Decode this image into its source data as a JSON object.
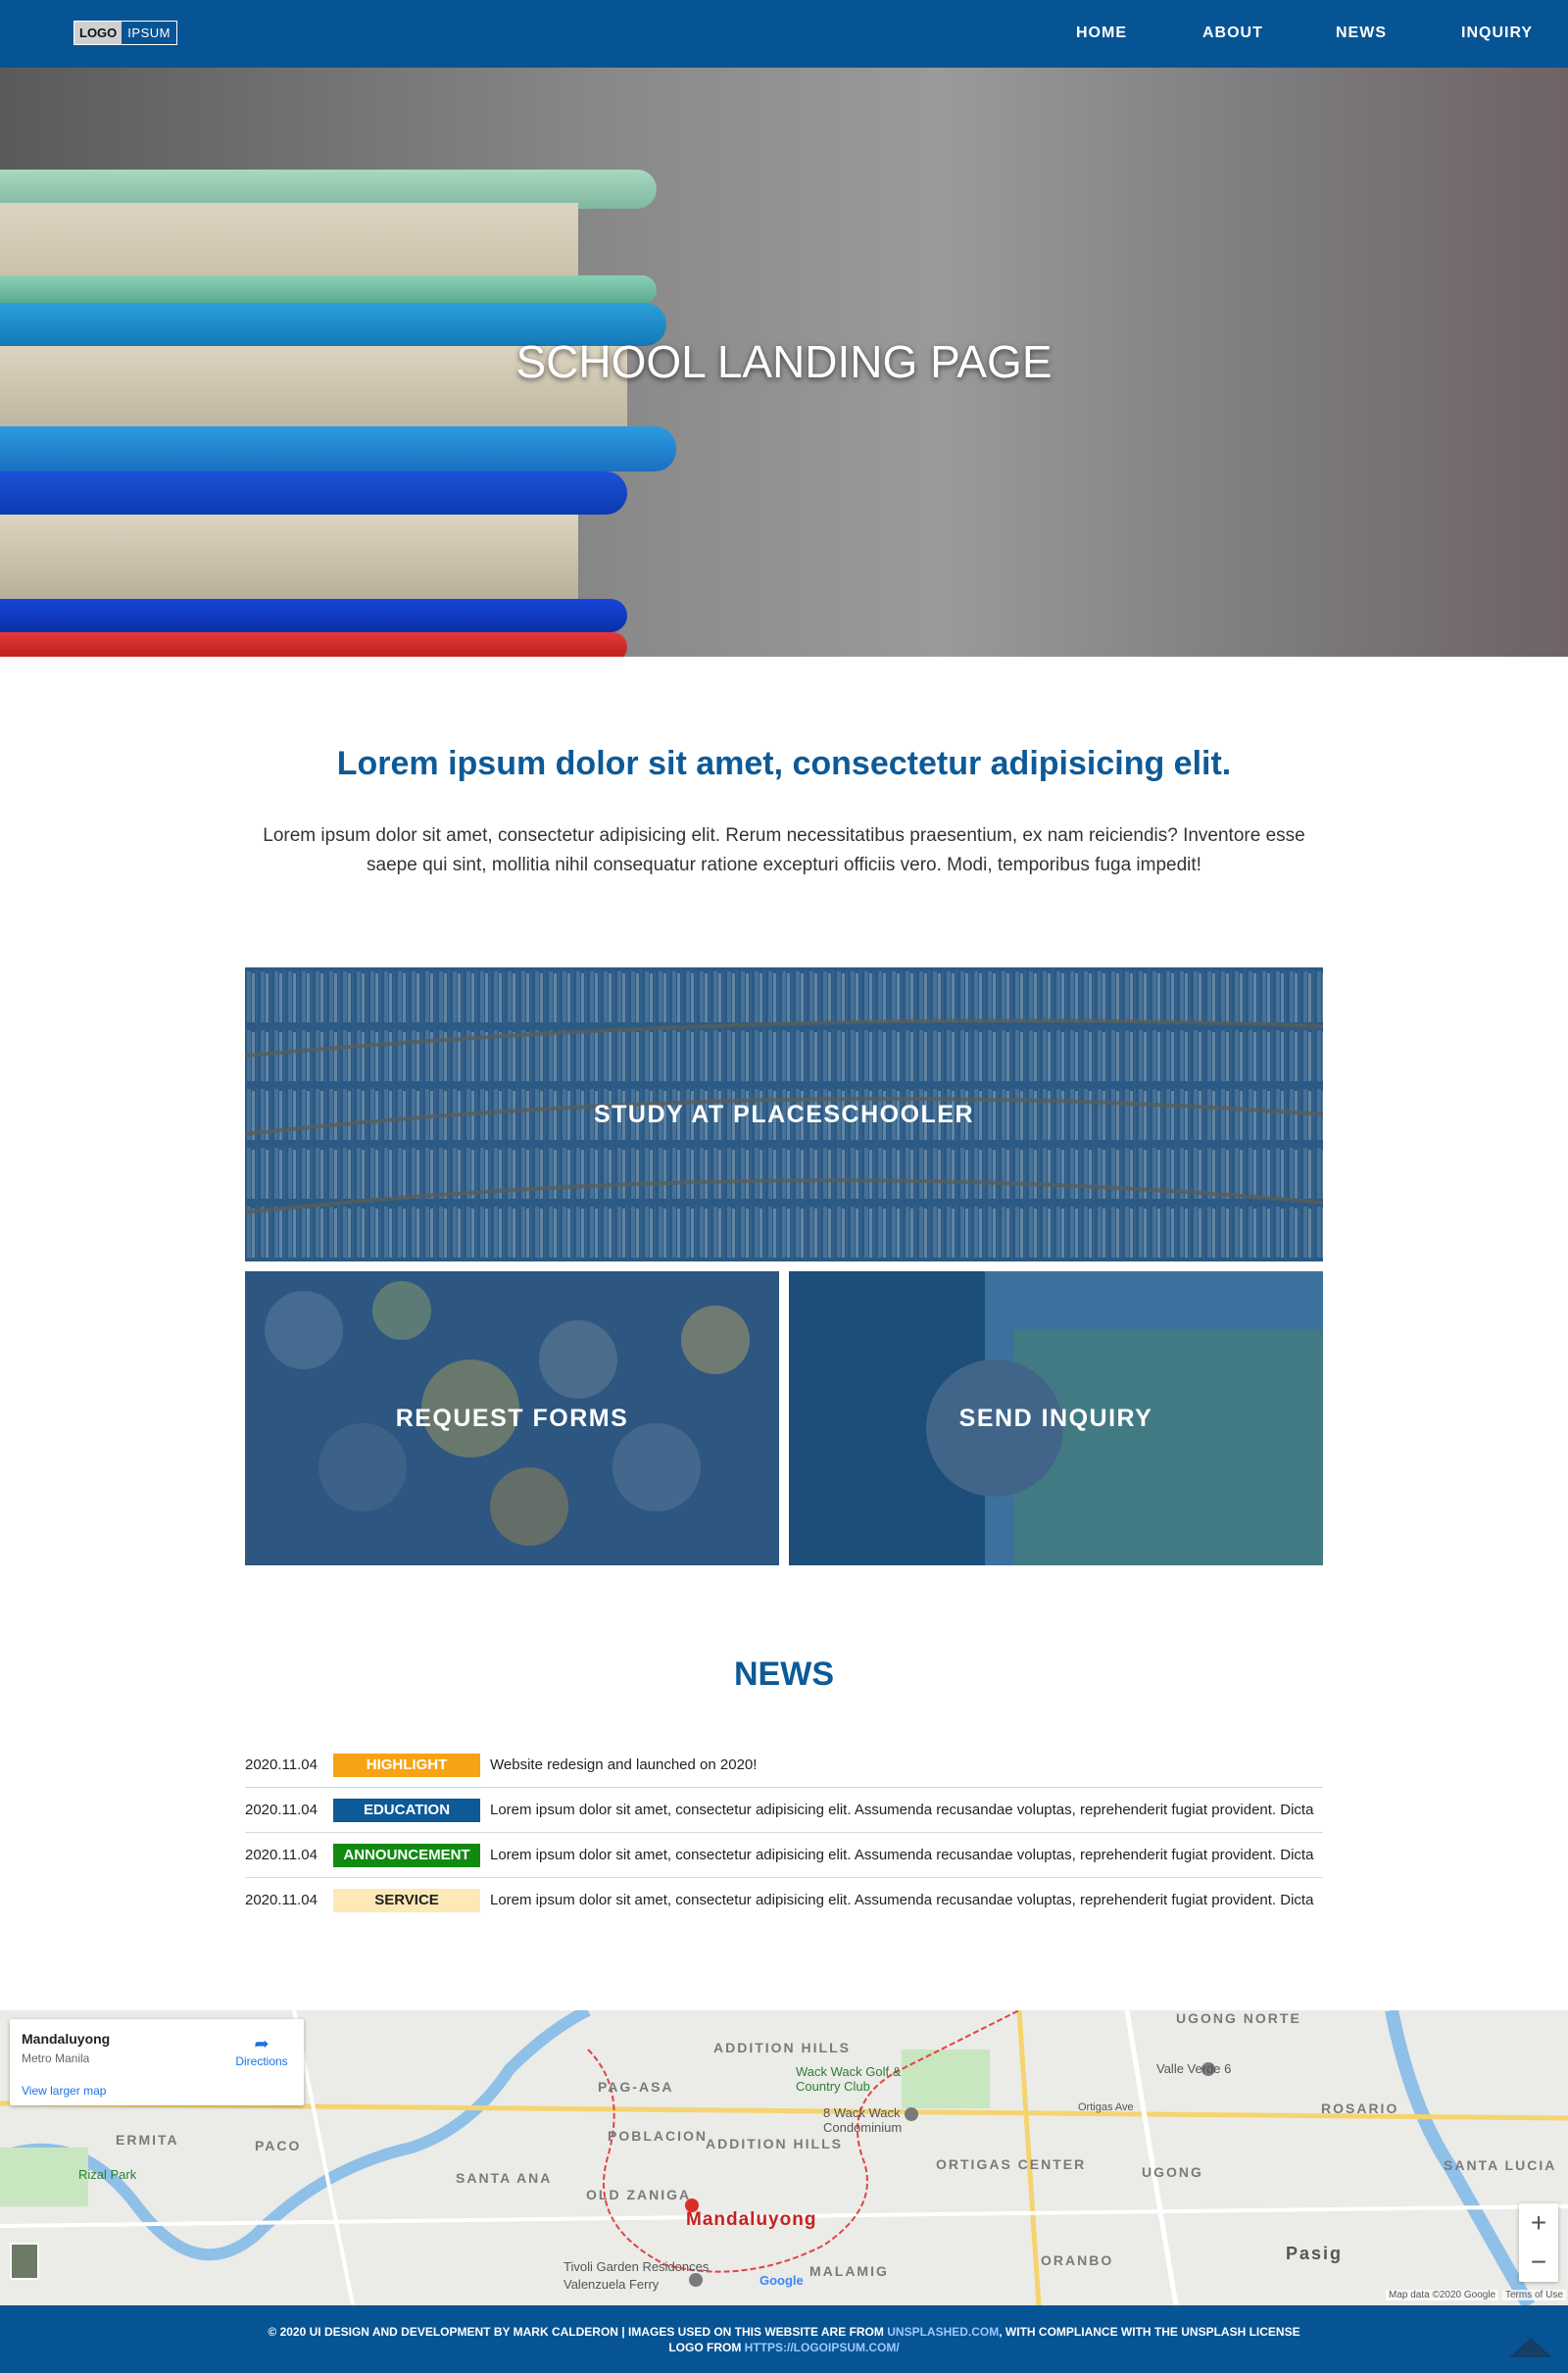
{
  "header": {
    "logo_part1": "LOGO",
    "logo_part2": "IPSUM",
    "nav": [
      "HOME",
      "ABOUT",
      "NEWS",
      "INQUIRY"
    ]
  },
  "hero": {
    "title": "SCHOOL LANDING PAGE"
  },
  "intro": {
    "heading": "Lorem ipsum dolor sit amet, consectetur adipisicing elit.",
    "text": "Lorem ipsum dolor sit amet, consectetur adipisicing elit. Rerum necessitatibus praesentium, ex nam reiciendis? Inventore esse saepe qui sint, mollitia nihil consequatur ratione excepturi officiis vero. Modi, temporibus fuga impedit!"
  },
  "cards": {
    "study": "STUDY AT PLACESCHOOLER",
    "forms": "REQUEST FORMS",
    "inquiry": "SEND INQUIRY"
  },
  "news": {
    "heading": "NEWS",
    "items": [
      {
        "date": "2020.11.04",
        "tag": "HIGHLIGHT",
        "tag_color": "#f7a314",
        "tag_text_color": "#ffffff",
        "text": "Website redesign and launched on 2020!"
      },
      {
        "date": "2020.11.04",
        "tag": "EDUCATION",
        "tag_color": "#0d5a98",
        "tag_text_color": "#ffffff",
        "text": "Lorem ipsum dolor sit amet, consectetur adipisicing elit. Assumenda recusandae voluptas, reprehenderit fugiat provident. Dicta"
      },
      {
        "date": "2020.11.04",
        "tag": "ANNOUNCEMENT",
        "tag_color": "#118a11",
        "tag_text_color": "#ffffff",
        "text": "Lorem ipsum dolor sit amet, consectetur adipisicing elit. Assumenda recusandae voluptas, reprehenderit fugiat provident. Dicta"
      },
      {
        "date": "2020.11.04",
        "tag": "SERVICE",
        "tag_color": "#fde9b8",
        "tag_text_color": "#222222",
        "text": "Lorem ipsum dolor sit amet, consectetur adipisicing elit. Assumenda recusandae voluptas, reprehenderit fugiat provident. Dicta"
      }
    ]
  },
  "map": {
    "place": "Mandaluyong",
    "region": "Metro Manila",
    "larger_map": "View larger map",
    "directions": "Directions",
    "labels": {
      "city": "Mandaluyong",
      "ortigas": "ORTIGAS CENTER",
      "addition_hills": "ADDITION HILLS",
      "poblacion": "POBLACION",
      "old_zaniga": "OLD ZANIGA",
      "malamig": "MALAMIG",
      "pag_asa": "PAG-ASA",
      "ugong": "UGONG",
      "ugong_norte": "UGONG NORTE",
      "rosario": "ROSARIO",
      "santa_lucia": "SANTA LUCIA",
      "santa_ana": "SANTA ANA",
      "ermita": "ERMITA",
      "paco": "PACO",
      "orano": "ORANBO",
      "pasig": "Pasig",
      "valle_verde": "Valle Verde 6",
      "wack_wack": "Wack Wack Golf & Country Club",
      "wack_wack_condo": "8 Wack Wack Condominium",
      "rizal_park": "Rizal Park",
      "tivoli": "Tivoli Garden Residences",
      "valenzuela": "Valenzuela Ferry",
      "ortigas_ave": "Ortigas Ave",
      "google": "Google",
      "map_data": "Map data ©2020 Google",
      "terms": "Terms of Use"
    }
  },
  "footer": {
    "line1_prefix": "© 2020 UI DESIGN AND DEVELOPMENT BY MARK CALDERON | IMAGES USED ON THIS WEBSITE ARE FROM ",
    "line1_link": "UNSPLASHED.COM",
    "line1_suffix": ", WITH COMPLIANCE WITH THE UNSPLASH LICENSE",
    "line2_prefix": "LOGO FROM ",
    "line2_link": "HTTPS://LOGOIPSUM.COM/"
  }
}
